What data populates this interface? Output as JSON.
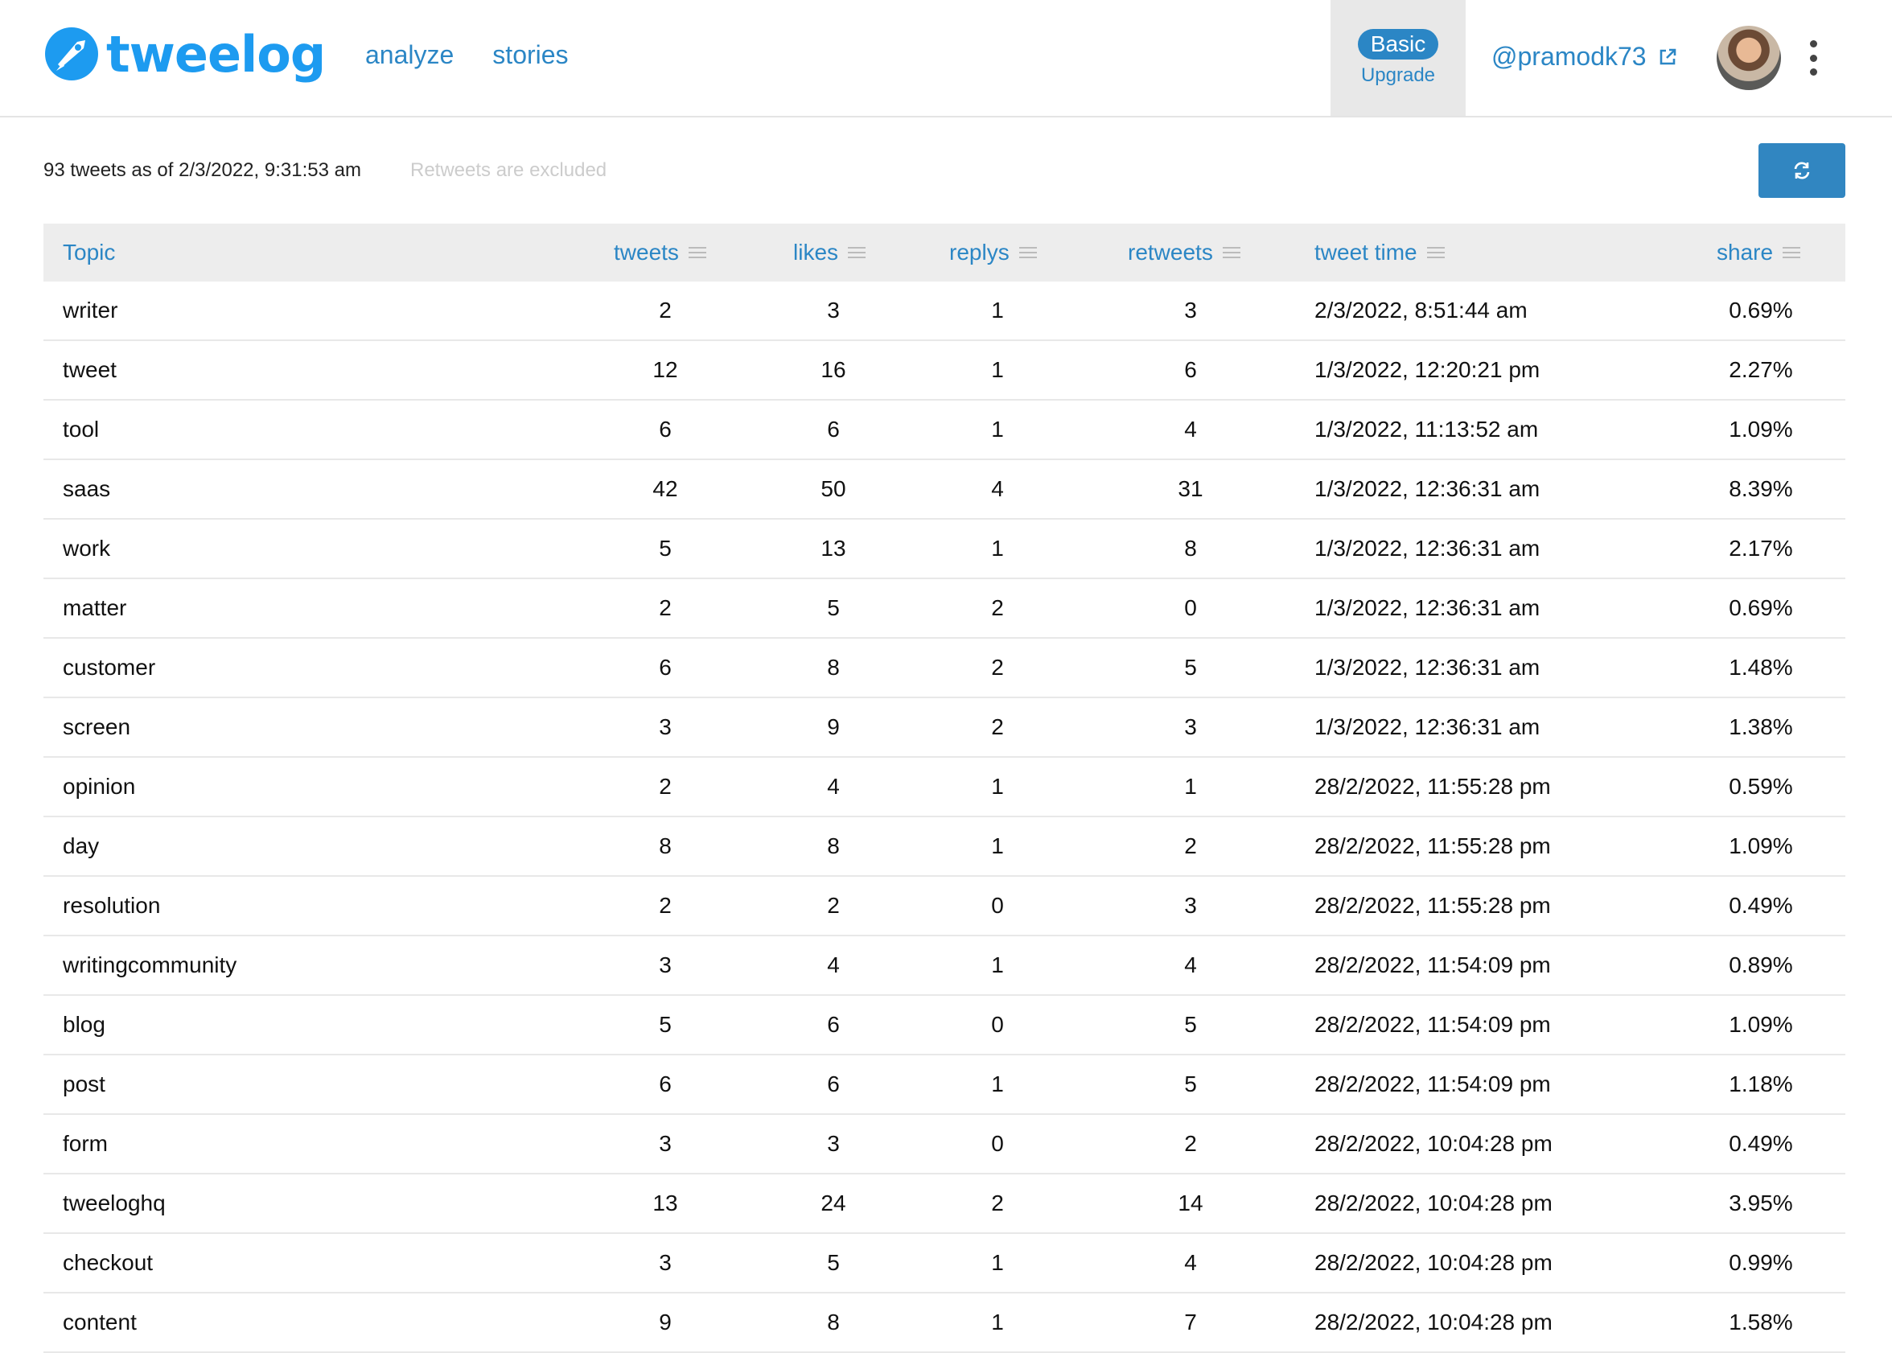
{
  "header": {
    "logo_text": "tweelog",
    "nav": [
      "analyze",
      "stories"
    ],
    "plan_label": "Basic",
    "upgrade_label": "Upgrade",
    "user_handle": "@pramodk73"
  },
  "summary": {
    "count_text": "93 tweets as of 2/3/2022, 9:31:53 am",
    "note": "Retweets are excluded"
  },
  "table": {
    "columns": [
      "Topic",
      "tweets",
      "likes",
      "replys",
      "retweets",
      "tweet time",
      "share"
    ],
    "rows": [
      {
        "topic": "writer",
        "tweets": "2",
        "likes": "3",
        "replys": "1",
        "retweets": "3",
        "time": "2/3/2022, 8:51:44 am",
        "share": "0.69%"
      },
      {
        "topic": "tweet",
        "tweets": "12",
        "likes": "16",
        "replys": "1",
        "retweets": "6",
        "time": "1/3/2022, 12:20:21 pm",
        "share": "2.27%"
      },
      {
        "topic": "tool",
        "tweets": "6",
        "likes": "6",
        "replys": "1",
        "retweets": "4",
        "time": "1/3/2022, 11:13:52 am",
        "share": "1.09%"
      },
      {
        "topic": "saas",
        "tweets": "42",
        "likes": "50",
        "replys": "4",
        "retweets": "31",
        "time": "1/3/2022, 12:36:31 am",
        "share": "8.39%"
      },
      {
        "topic": "work",
        "tweets": "5",
        "likes": "13",
        "replys": "1",
        "retweets": "8",
        "time": "1/3/2022, 12:36:31 am",
        "share": "2.17%"
      },
      {
        "topic": "matter",
        "tweets": "2",
        "likes": "5",
        "replys": "2",
        "retweets": "0",
        "time": "1/3/2022, 12:36:31 am",
        "share": "0.69%"
      },
      {
        "topic": "customer",
        "tweets": "6",
        "likes": "8",
        "replys": "2",
        "retweets": "5",
        "time": "1/3/2022, 12:36:31 am",
        "share": "1.48%"
      },
      {
        "topic": "screen",
        "tweets": "3",
        "likes": "9",
        "replys": "2",
        "retweets": "3",
        "time": "1/3/2022, 12:36:31 am",
        "share": "1.38%"
      },
      {
        "topic": "opinion",
        "tweets": "2",
        "likes": "4",
        "replys": "1",
        "retweets": "1",
        "time": "28/2/2022, 11:55:28 pm",
        "share": "0.59%"
      },
      {
        "topic": "day",
        "tweets": "8",
        "likes": "8",
        "replys": "1",
        "retweets": "2",
        "time": "28/2/2022, 11:55:28 pm",
        "share": "1.09%"
      },
      {
        "topic": "resolution",
        "tweets": "2",
        "likes": "2",
        "replys": "0",
        "retweets": "3",
        "time": "28/2/2022, 11:55:28 pm",
        "share": "0.49%"
      },
      {
        "topic": "writingcommunity",
        "tweets": "3",
        "likes": "4",
        "replys": "1",
        "retweets": "4",
        "time": "28/2/2022, 11:54:09 pm",
        "share": "0.89%"
      },
      {
        "topic": "blog",
        "tweets": "5",
        "likes": "6",
        "replys": "0",
        "retweets": "5",
        "time": "28/2/2022, 11:54:09 pm",
        "share": "1.09%"
      },
      {
        "topic": "post",
        "tweets": "6",
        "likes": "6",
        "replys": "1",
        "retweets": "5",
        "time": "28/2/2022, 11:54:09 pm",
        "share": "1.18%"
      },
      {
        "topic": "form",
        "tweets": "3",
        "likes": "3",
        "replys": "0",
        "retweets": "2",
        "time": "28/2/2022, 10:04:28 pm",
        "share": "0.49%"
      },
      {
        "topic": "tweeloghq",
        "tweets": "13",
        "likes": "24",
        "replys": "2",
        "retweets": "14",
        "time": "28/2/2022, 10:04:28 pm",
        "share": "3.95%"
      },
      {
        "topic": "checkout",
        "tweets": "3",
        "likes": "5",
        "replys": "1",
        "retweets": "4",
        "time": "28/2/2022, 10:04:28 pm",
        "share": "0.99%"
      },
      {
        "topic": "content",
        "tweets": "9",
        "likes": "8",
        "replys": "1",
        "retweets": "7",
        "time": "28/2/2022, 10:04:28 pm",
        "share": "1.58%"
      }
    ]
  },
  "icons": {
    "logo": "rocket-logo-icon",
    "external_link": "external-link-icon",
    "menu": "kebab-menu-icon",
    "refresh": "refresh-icon",
    "column_menu": "column-menu-icon"
  },
  "colors": {
    "brand": "#1d9bf0",
    "accent": "#2b86c5",
    "header_bg": "#ededed"
  }
}
